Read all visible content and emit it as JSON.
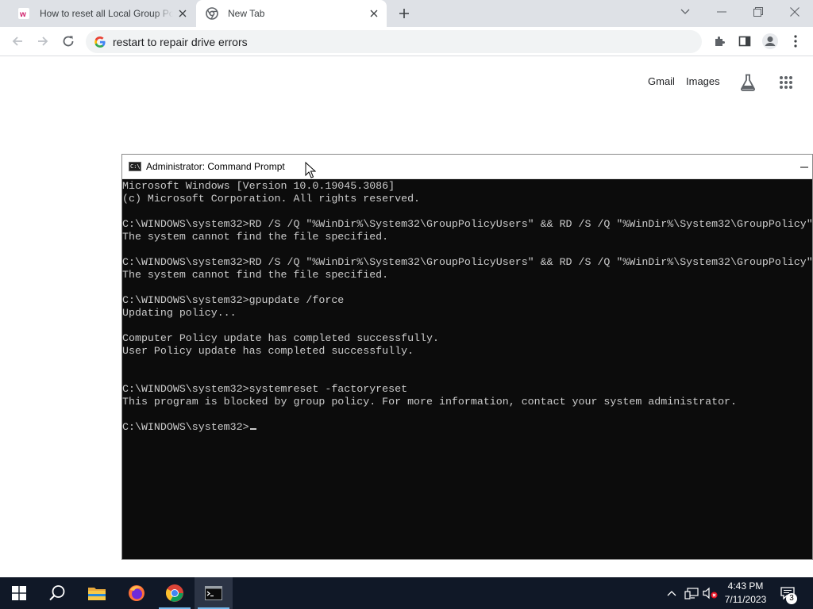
{
  "browser": {
    "tabs": [
      {
        "title": "How to reset all Local Group Poli",
        "active": false
      },
      {
        "title": "New Tab",
        "active": true
      }
    ],
    "address_bar": {
      "value": "restart to repair drive errors"
    },
    "ntp_links": {
      "gmail": "Gmail",
      "images": "Images"
    }
  },
  "cmd_window": {
    "title": "Administrator:  Command Prompt",
    "lines": [
      "Microsoft Windows [Version 10.0.19045.3086]",
      "(c) Microsoft Corporation. All rights reserved.",
      "",
      "C:\\WINDOWS\\system32>RD /S /Q \"%WinDir%\\System32\\GroupPolicyUsers\" && RD /S /Q \"%WinDir%\\System32\\GroupPolicy\"",
      "The system cannot find the file specified.",
      "",
      "C:\\WINDOWS\\system32>RD /S /Q \"%WinDir%\\System32\\GroupPolicyUsers\" && RD /S /Q \"%WinDir%\\System32\\GroupPolicy\"",
      "The system cannot find the file specified.",
      "",
      "C:\\WINDOWS\\system32>gpupdate /force",
      "Updating policy...",
      "",
      "Computer Policy update has completed successfully.",
      "User Policy update has completed successfully.",
      "",
      "",
      "C:\\WINDOWS\\system32>systemreset -factoryreset",
      "This program is blocked by group policy. For more information, contact your system administrator.",
      ""
    ],
    "prompt": "C:\\WINDOWS\\system32>"
  },
  "taskbar": {
    "time": "4:43 PM",
    "date": "7/11/2023",
    "notification_count": "3"
  },
  "colors": {
    "tabstrip": "#dee1e6",
    "console_bg": "#0c0c0c",
    "console_fg": "#cccccc",
    "taskbar_bg": "#101827"
  }
}
